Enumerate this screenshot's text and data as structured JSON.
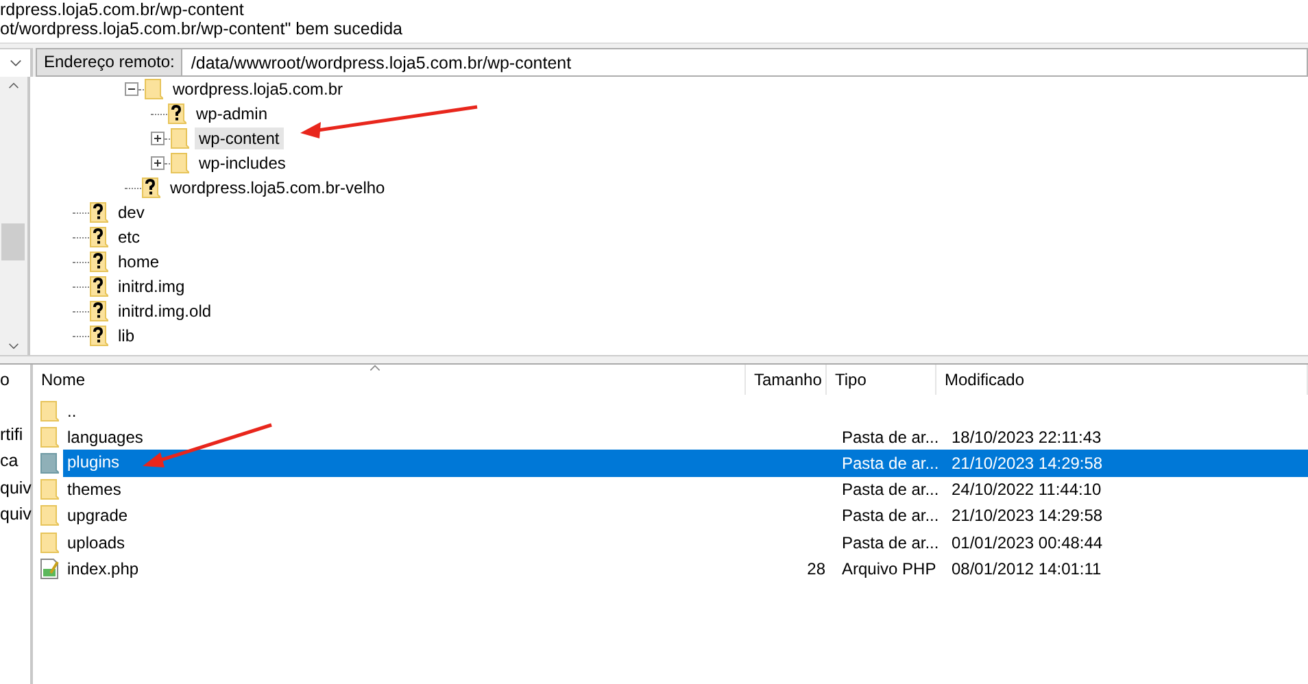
{
  "log": {
    "lines": [
      "rdpress.loja5.com.br/wp-content",
      "ot/wordpress.loja5.com.br/wp-content\" bem sucedida"
    ]
  },
  "remote_address": {
    "label": "Endereço remoto:",
    "value": "/data/wwwroot/wordpress.loja5.com.br/wp-content"
  },
  "local_pane": {
    "items": [
      "o",
      "rtifi",
      "ca",
      "quiv",
      "quiv"
    ]
  },
  "tree": {
    "items": [
      {
        "children": [
          {
            "children": [
              {
                "label": "wordpress.loja5.com.br",
                "kind": "folder",
                "expanded": true,
                "selected": false,
                "children": [
                  {
                    "label": "wp-admin",
                    "kind": "unknown",
                    "selected": false
                  },
                  {
                    "label": "wp-content",
                    "kind": "folder",
                    "expanded": false,
                    "selected": true
                  },
                  {
                    "label": "wp-includes",
                    "kind": "folder",
                    "expanded": false,
                    "selected": false
                  }
                ]
              },
              {
                "label": "wordpress.loja5.com.br-velho",
                "kind": "unknown",
                "selected": false
              }
            ]
          }
        ]
      },
      {
        "label": "dev",
        "kind": "unknown",
        "selected": false
      },
      {
        "label": "etc",
        "kind": "unknown",
        "selected": false
      },
      {
        "label": "home",
        "kind": "unknown",
        "selected": false
      },
      {
        "label": "initrd.img",
        "kind": "unknown",
        "selected": false
      },
      {
        "label": "initrd.img.old",
        "kind": "unknown",
        "selected": false
      },
      {
        "label": "lib",
        "kind": "unknown",
        "selected": false
      }
    ]
  },
  "file_list": {
    "columns": [
      {
        "label": "Nome",
        "sorted": true
      },
      {
        "label": "Tamanho",
        "sorted": false
      },
      {
        "label": "Tipo",
        "sorted": false
      },
      {
        "label": "Modificado",
        "sorted": false
      }
    ],
    "rows": [
      {
        "kind": "folder",
        "name": "..",
        "selected": false
      },
      {
        "kind": "folder",
        "name": "languages",
        "type": "Pasta de ar...",
        "modified": "18/10/2023 22:11:43",
        "selected": false
      },
      {
        "kind": "folder",
        "name": "plugins",
        "type": "Pasta de ar...",
        "modified": "21/10/2023 14:29:58",
        "selected": true
      },
      {
        "kind": "folder",
        "name": "themes",
        "type": "Pasta de ar...",
        "modified": "24/10/2022 11:44:10",
        "selected": false
      },
      {
        "kind": "folder",
        "name": "upgrade",
        "type": "Pasta de ar...",
        "modified": "21/10/2023 14:29:58",
        "selected": false
      },
      {
        "kind": "folder",
        "name": "uploads",
        "type": "Pasta de ar...",
        "modified": "01/01/2023 00:48:44",
        "selected": false
      },
      {
        "kind": "file",
        "name": "index.php",
        "size": "28",
        "type": "Arquivo PHP",
        "modified": "08/01/2012 14:01:11",
        "selected": false
      }
    ]
  }
}
